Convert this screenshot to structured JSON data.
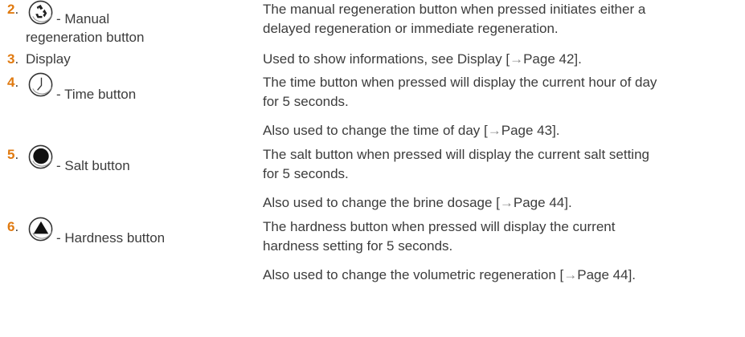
{
  "items": [
    {
      "number": "2",
      "label_line1": "- Manual",
      "label_line2": "regeneration button",
      "icon": "recycle-icon",
      "desc": [
        "The manual regeneration button when pressed initiates either a",
        "delayed regeneration or immediate regeneration."
      ]
    },
    {
      "number": "3",
      "label": "Display",
      "desc_prefix": "Used to show informations, see Display [",
      "desc_arrow": "→",
      "desc_suffix": "Page 42]."
    },
    {
      "number": "4",
      "label": "- Time button",
      "icon": "clock-icon",
      "desc": [
        "The time button when pressed will display the current hour of day",
        "for 5 seconds."
      ],
      "extra_prefix": "Also used to change the time of day [",
      "extra_arrow": "→",
      "extra_suffix": "Page 43]."
    },
    {
      "number": "5",
      "label": "- Salt button",
      "icon": "filled-circle-icon",
      "desc": [
        "The salt button when pressed will display the current salt setting",
        "for 5 seconds."
      ],
      "extra_prefix": "Also used to change the brine dosage [",
      "extra_arrow": "→",
      "extra_suffix": "Page 44]."
    },
    {
      "number": "6",
      "label": "- Hardness button",
      "icon": "triangle-up-icon",
      "desc": [
        "The hardness button when pressed will display the current",
        "hardness setting for 5 seconds."
      ],
      "extra_prefix": "Also used to change the volumetric regeneration [",
      "extra_arrow": "→",
      "extra_suffix": "Page 44]."
    }
  ]
}
